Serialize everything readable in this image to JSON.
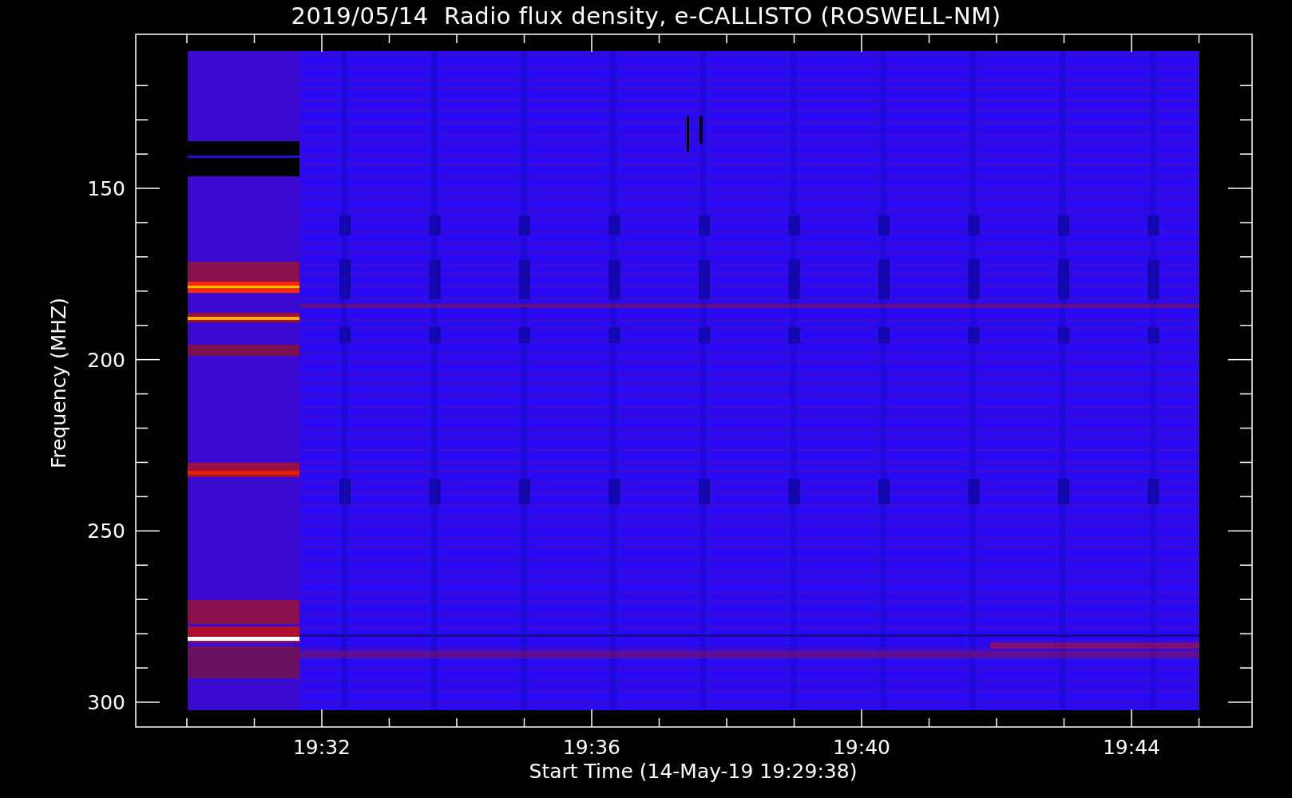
{
  "title": "2019/05/14  Radio flux density, e-CALLISTO (ROSWELL-NM)",
  "y_axis": {
    "label": "Frequency (MHZ)",
    "ticks": [
      "150",
      "200",
      "250",
      "300"
    ]
  },
  "x_axis": {
    "label": "Start Time (14-May-19 19:29:38)",
    "ticks": [
      "19:32",
      "19:36",
      "19:40",
      "19:44"
    ]
  }
}
